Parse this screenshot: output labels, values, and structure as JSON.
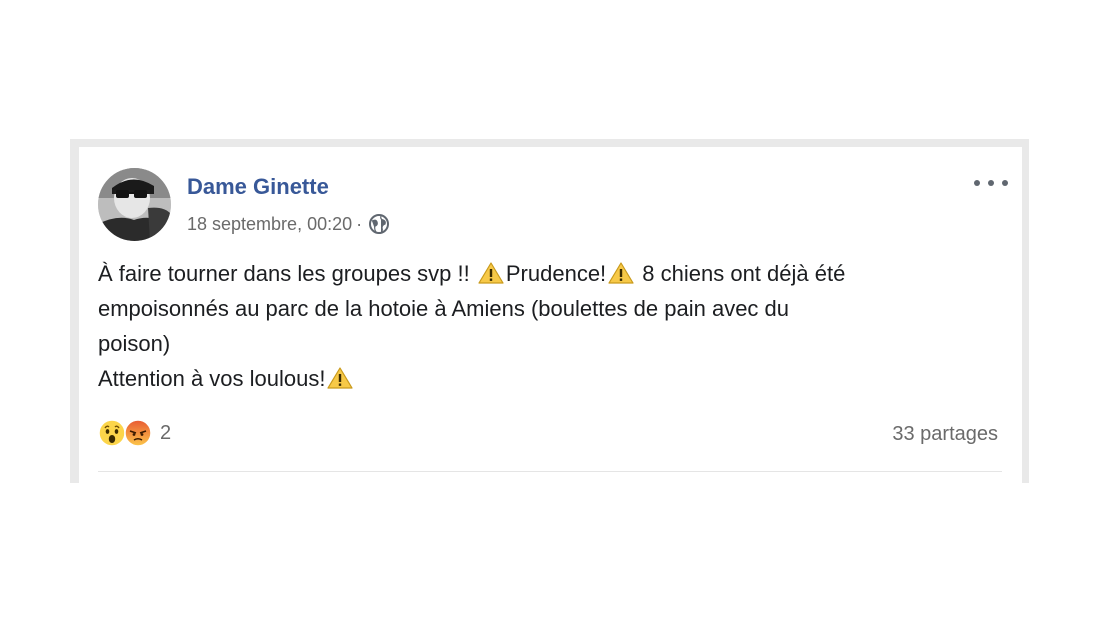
{
  "post": {
    "author": "Dame Ginette",
    "timestamp": "18 septembre, 00:20",
    "separator": "·",
    "privacy_icon": "globe-icon",
    "more_icon": "more-options-icon",
    "lines": [
      {
        "segments": [
          "À faire tourner dans les groupes svp !! ",
          "warn",
          "Prudence!",
          "warn",
          " 8 chiens ont déjà été"
        ]
      },
      {
        "segments": [
          "empoisonnés au parc de la hotoie à Amiens (boulettes de pain avec du"
        ]
      },
      {
        "segments": [
          "poison)"
        ]
      },
      {
        "segments": [
          "Attention à vos loulous!",
          "warn"
        ]
      }
    ],
    "reactions": {
      "icons": [
        "wow-reaction-icon",
        "angry-reaction-icon"
      ],
      "count": "2"
    },
    "shares": "33 partages"
  },
  "colors": {
    "author": "#385898",
    "meta": "#6a6a6a",
    "text": "#1c1e21",
    "frame": "#e9e9e9"
  }
}
